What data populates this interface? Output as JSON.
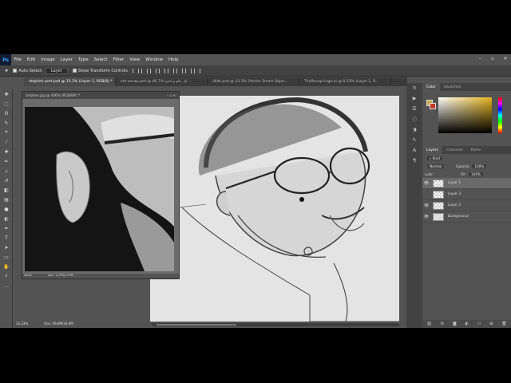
{
  "menubar": {
    "logo": "Ps",
    "items": [
      "File",
      "Edit",
      "Image",
      "Layer",
      "Type",
      "Select",
      "Filter",
      "View",
      "Window",
      "Help"
    ]
  },
  "options": {
    "auto_select_label": "Auto-Select:",
    "auto_select_value": "Layer",
    "transform_label": "Show Transform Controls"
  },
  "tabs": [
    {
      "label": "stephen port.psd @ 33.3% (Layer 1, RGB/8) *"
    },
    {
      "label": "eid vecap.psd @ 46.7% (كل عام و انتم ..."
    },
    {
      "label": "allah.psd @ 33.3% (Vector Smart Objec..."
    },
    {
      "label": "TheRecap-Logo.ai @ 8.33% (Layer 1, R..."
    }
  ],
  "float_window": {
    "title": "stephen.jpg @ 446% (RGB/8#) *",
    "zoom": "400%",
    "doc": "Doc: 1.07M/1.07M"
  },
  "status": {
    "zoom": "33.33%",
    "doc": "Doc: 49.8M/34.9M"
  },
  "panels": {
    "color_tabs": [
      "Color",
      "Swatches"
    ],
    "layers_tabs": [
      "Layers",
      "Channels",
      "Paths"
    ],
    "kind_label": "Kind",
    "blend_mode": "Normal",
    "opacity_label": "Opacity:",
    "opacity_value": "100%",
    "lock_label": "Lock:",
    "fill_label": "Fill:",
    "fill_value": "100%"
  },
  "layers": [
    {
      "name": "Layer 1",
      "selected": true,
      "italic": false
    },
    {
      "name": "Layer 3",
      "selected": false,
      "italic": false
    },
    {
      "name": "Layer 2",
      "selected": false,
      "italic": false
    },
    {
      "name": "Background",
      "selected": false,
      "italic": true
    }
  ],
  "colors": {
    "foreground": "#c8a84a",
    "background": "#c0392b",
    "accent": "#31a8ff"
  }
}
